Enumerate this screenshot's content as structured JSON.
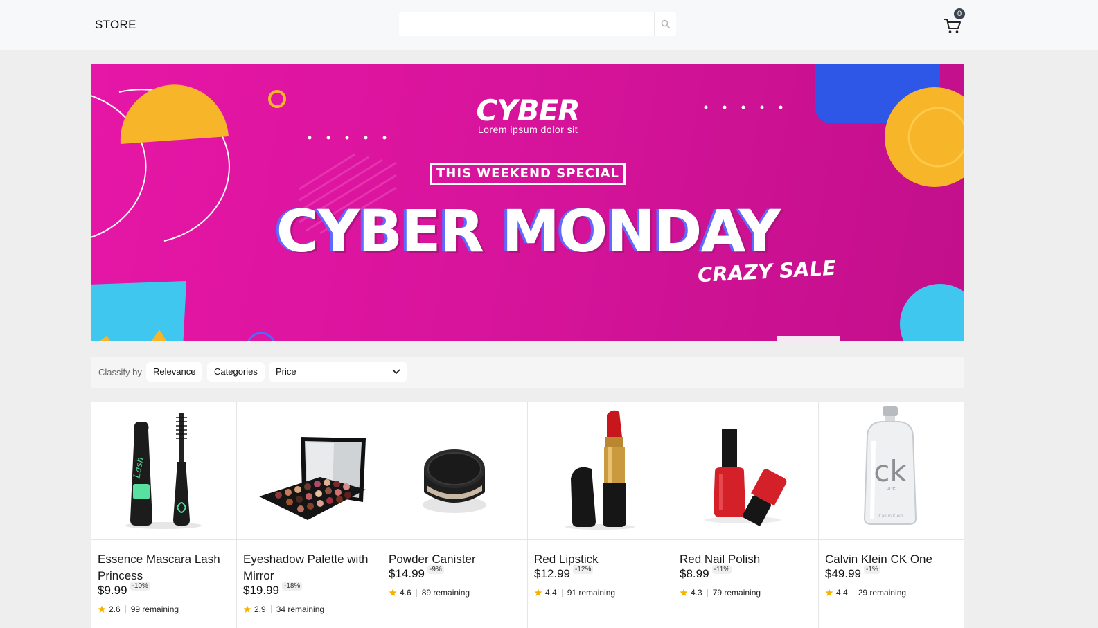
{
  "header": {
    "logo": "STORE",
    "search_placeholder": "",
    "cart_count": "0"
  },
  "banner": {
    "logo_text": "CYBER",
    "tagline": "Lorem ipsum dolor sit",
    "special": "THIS WEEKEND SPECIAL",
    "headline": "CYBER MONDAY",
    "subline": "CRAZY SALE"
  },
  "filters": {
    "label": "Classify by",
    "relevance": "Relevance",
    "categories": "Categories",
    "price": "Price"
  },
  "products": [
    {
      "title": "Essence Mascara Lash Princess",
      "price": "$9.99",
      "discount": "-10%",
      "rating": "2.6",
      "stock": "99 remaining",
      "icon": "mascara-image"
    },
    {
      "title": "Eyeshadow Palette with Mirror",
      "price": "$19.99",
      "discount": "-18%",
      "rating": "2.9",
      "stock": "34 remaining",
      "icon": "eyeshadow-palette-image"
    },
    {
      "title": "Powder Canister",
      "price": "$14.99",
      "discount": "-9%",
      "rating": "4.6",
      "stock": "89 remaining",
      "icon": "powder-canister-image"
    },
    {
      "title": "Red Lipstick",
      "price": "$12.99",
      "discount": "-12%",
      "rating": "4.4",
      "stock": "91 remaining",
      "icon": "lipstick-image"
    },
    {
      "title": "Red Nail Polish",
      "price": "$8.99",
      "discount": "-11%",
      "rating": "4.3",
      "stock": "79 remaining",
      "icon": "nail-polish-image"
    },
    {
      "title": "Calvin Klein CK One",
      "price": "$49.99",
      "discount": "-1%",
      "rating": "4.4",
      "stock": "29 remaining",
      "icon": "perfume-bottle-image"
    }
  ],
  "colors": {
    "banner_magenta": "#d8149c",
    "star": "#f5b301",
    "badge": "#3d4451"
  }
}
